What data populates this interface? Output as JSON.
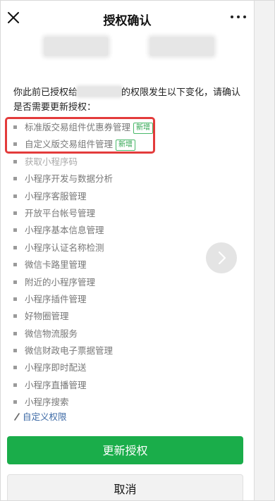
{
  "header": {
    "title": "授权确认",
    "close_icon": "close-icon",
    "more_icon": "more-dots-icon"
  },
  "intro": {
    "text_before": "你此前已授权给",
    "text_after": "的权限发生以下变化，请确认是否需要更新授权："
  },
  "permissions": [
    {
      "label": "标准版交易组件优惠券管理",
      "badge": "新增"
    },
    {
      "label": "自定义版交易组件管理",
      "badge": "新增"
    },
    {
      "label": "获取小程序码"
    },
    {
      "label": "小程序开发与数据分析"
    },
    {
      "label": "小程序客服管理"
    },
    {
      "label": "开放平台帐号管理"
    },
    {
      "label": "小程序基本信息管理"
    },
    {
      "label": "小程序认证名称检测"
    },
    {
      "label": "微信卡路里管理"
    },
    {
      "label": "附近的小程序管理"
    },
    {
      "label": "小程序插件管理"
    },
    {
      "label": "好物圈管理"
    },
    {
      "label": "微信物流服务"
    },
    {
      "label": "微信财政电子票据管理"
    },
    {
      "label": "小程序即时配送"
    },
    {
      "label": "小程序直播管理"
    },
    {
      "label": "小程序搜索"
    }
  ],
  "custom_permission_link": "自定义权限",
  "buttons": {
    "update": "更新授权",
    "cancel": "取消"
  },
  "colors": {
    "primary": "#1aad4a",
    "highlight_box": "#e33b3b",
    "link": "#3d6aa6",
    "badge": "#2ea44f"
  }
}
